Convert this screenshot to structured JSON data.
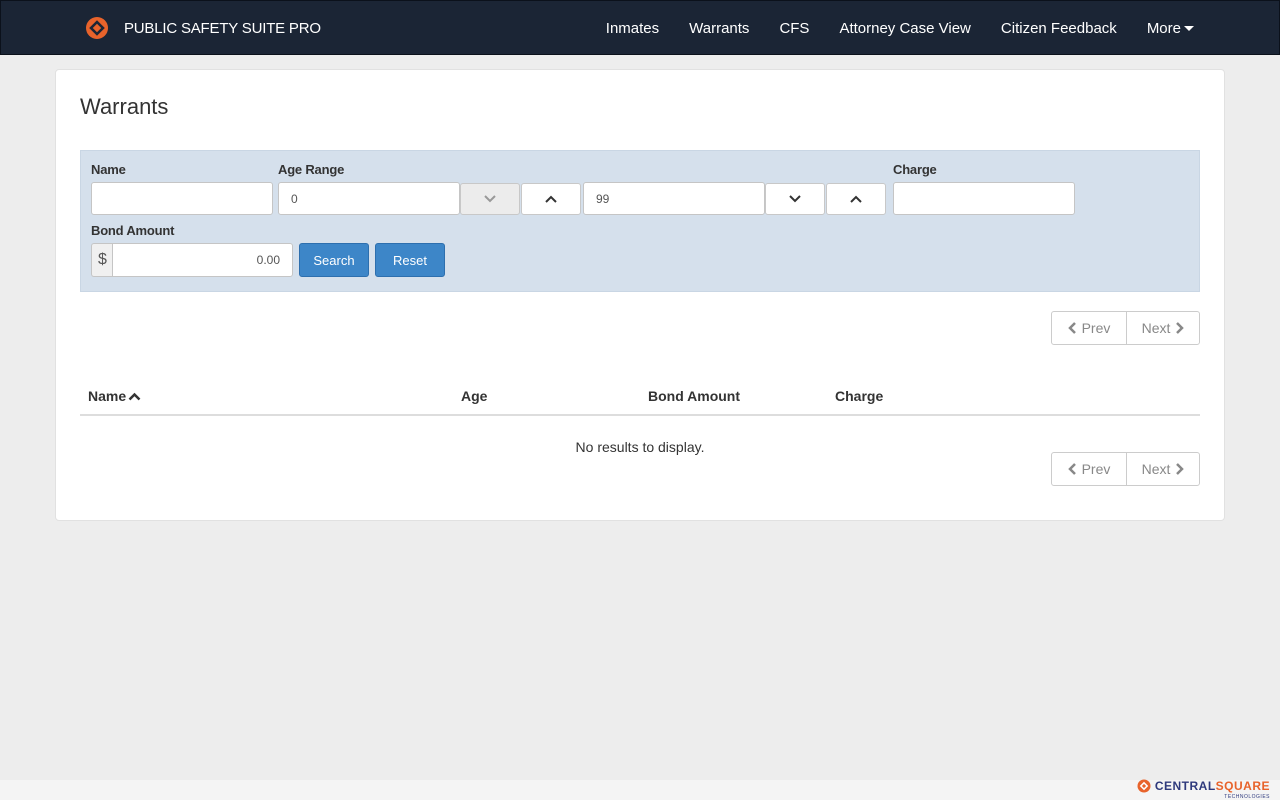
{
  "app": {
    "brand": "PUBLIC SAFETY SUITE PRO",
    "brand_color": "#e8632b",
    "nav_bg": "#1b2535"
  },
  "nav": {
    "items": [
      "Inmates",
      "Warrants",
      "CFS",
      "Attorney Case View",
      "Citizen Feedback"
    ],
    "more_label": "More"
  },
  "page": {
    "title": "Warrants"
  },
  "filters": {
    "name_label": "Name",
    "name_value": "",
    "age_label": "Age Range",
    "age_min": "0",
    "age_max": "99",
    "charge_label": "Charge",
    "charge_value": "",
    "bond_label": "Bond Amount",
    "currency": "$",
    "bond_value": "0.00",
    "search_label": "Search",
    "reset_label": "Reset",
    "accent": "#3d86c8"
  },
  "pagination": {
    "prev": "Prev",
    "next": "Next"
  },
  "table": {
    "columns": [
      "Name",
      "Age",
      "Bond Amount",
      "Charge"
    ],
    "sort_column": "Name",
    "sort_direction": "ascending",
    "rows": [],
    "empty_message": "No results to display."
  },
  "footer": {
    "logo_part1": "CENTRAL",
    "logo_part2": "SQUARE",
    "logo_sub": "TECHNOLOGIES"
  }
}
